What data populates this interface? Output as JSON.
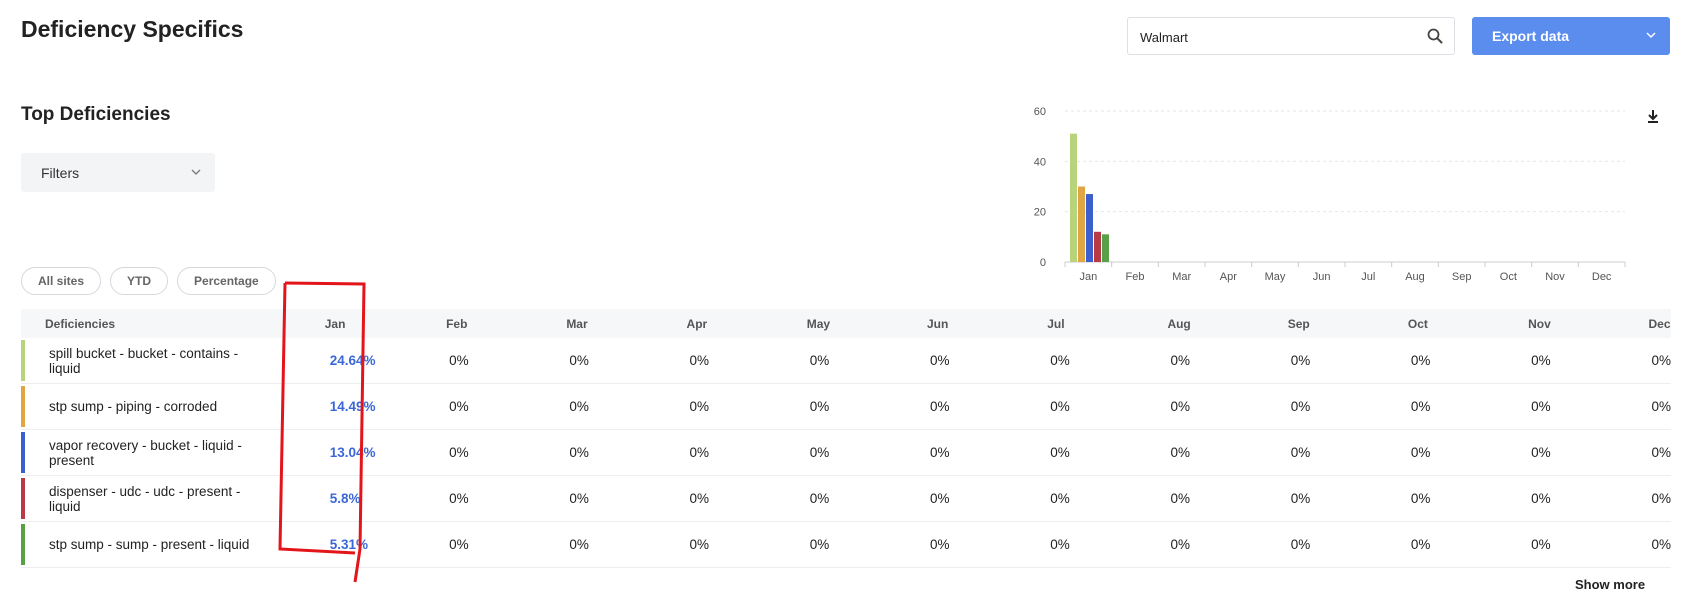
{
  "header": {
    "title": "Deficiency Specifics",
    "search_value": "Walmart",
    "export_label": "Export data"
  },
  "section": {
    "title": "Top Deficiencies",
    "filters_label": "Filters",
    "chips": [
      "All sites",
      "YTD",
      "Percentage"
    ]
  },
  "chart_data": {
    "type": "bar",
    "categories": [
      "Jan",
      "Feb",
      "Mar",
      "Apr",
      "May",
      "Jun",
      "Jul",
      "Aug",
      "Sep",
      "Oct",
      "Nov",
      "Dec"
    ],
    "ylim": [
      0,
      60
    ],
    "yticks": [
      0,
      20,
      40,
      60
    ],
    "series": [
      {
        "values": [
          51,
          0,
          0,
          0,
          0,
          0,
          0,
          0,
          0,
          0,
          0,
          0
        ],
        "color": "#b7d47c"
      },
      {
        "values": [
          30,
          0,
          0,
          0,
          0,
          0,
          0,
          0,
          0,
          0,
          0,
          0
        ],
        "color": "#e0a545"
      },
      {
        "values": [
          27,
          0,
          0,
          0,
          0,
          0,
          0,
          0,
          0,
          0,
          0,
          0
        ],
        "color": "#3b5fcf"
      },
      {
        "values": [
          12,
          0,
          0,
          0,
          0,
          0,
          0,
          0,
          0,
          0,
          0,
          0
        ],
        "color": "#b83a46"
      },
      {
        "values": [
          11,
          0,
          0,
          0,
          0,
          0,
          0,
          0,
          0,
          0,
          0,
          0
        ],
        "color": "#5aa046"
      }
    ],
    "grid": true
  },
  "table": {
    "columns": [
      "Deficiencies",
      "Jan",
      "Feb",
      "Mar",
      "Apr",
      "May",
      "Jun",
      "Jul",
      "Aug",
      "Sep",
      "Oct",
      "Nov",
      "Dec"
    ],
    "rows": [
      {
        "name": "spill bucket - bucket - contains - liquid",
        "color": "#b7d47c",
        "values": [
          "24.64%",
          "0%",
          "0%",
          "0%",
          "0%",
          "0%",
          "0%",
          "0%",
          "0%",
          "0%",
          "0%",
          "0%"
        ]
      },
      {
        "name": "stp sump - piping - corroded",
        "color": "#e0a545",
        "values": [
          "14.49%",
          "0%",
          "0%",
          "0%",
          "0%",
          "0%",
          "0%",
          "0%",
          "0%",
          "0%",
          "0%",
          "0%"
        ]
      },
      {
        "name": "vapor recovery - bucket - liquid - present",
        "color": "#3b5fcf",
        "values": [
          "13.04%",
          "0%",
          "0%",
          "0%",
          "0%",
          "0%",
          "0%",
          "0%",
          "0%",
          "0%",
          "0%",
          "0%"
        ]
      },
      {
        "name": "dispenser - udc - udc - present - liquid",
        "color": "#b83a46",
        "values": [
          "5.8%",
          "0%",
          "0%",
          "0%",
          "0%",
          "0%",
          "0%",
          "0%",
          "0%",
          "0%",
          "0%",
          "0%"
        ]
      },
      {
        "name": "stp sump - sump - present - liquid",
        "color": "#5aa046",
        "values": [
          "5.31%",
          "0%",
          "0%",
          "0%",
          "0%",
          "0%",
          "0%",
          "0%",
          "0%",
          "0%",
          "0%",
          "0%"
        ]
      }
    ]
  },
  "footer": {
    "show_more_label": "Show more"
  },
  "colors": {
    "accent": "#5b8def",
    "highlight": "#3b67d6",
    "annotation": "#e3151a"
  }
}
